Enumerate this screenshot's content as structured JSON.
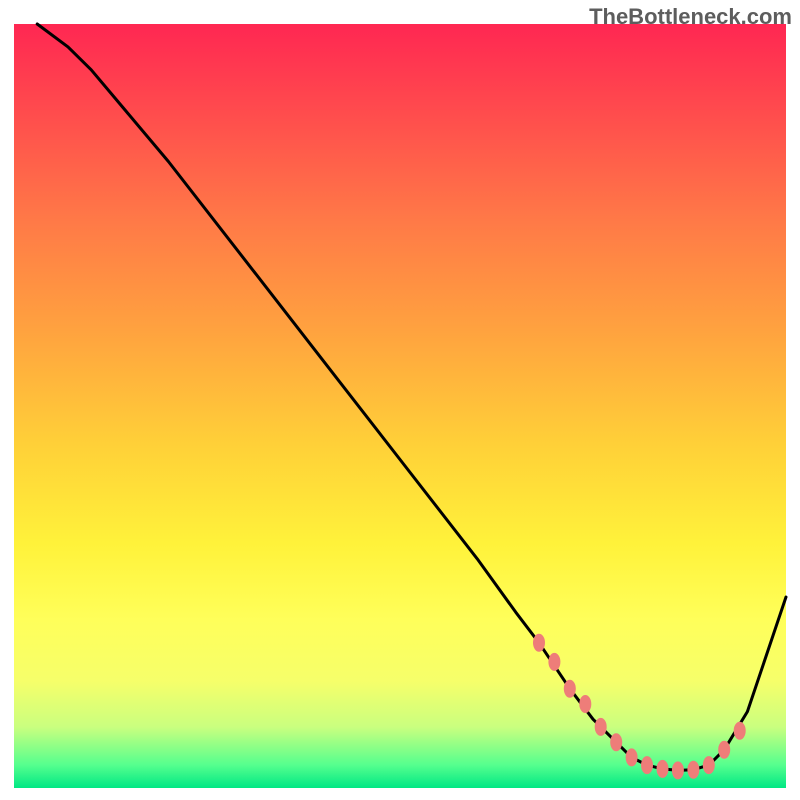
{
  "watermark": "TheBottleneck.com",
  "chart_data": {
    "type": "line",
    "title": "",
    "xlabel": "",
    "ylabel": "",
    "xlim": [
      0,
      100
    ],
    "ylim": [
      0,
      100
    ],
    "grid": false,
    "legend": false,
    "series": [
      {
        "name": "curve",
        "x": [
          3,
          7,
          10,
          20,
          30,
          40,
          50,
          60,
          65,
          68,
          72,
          75,
          78,
          80,
          82,
          84,
          86,
          88,
          90,
          92,
          95,
          100
        ],
        "y": [
          100,
          97,
          94,
          82,
          69,
          56,
          43,
          30,
          23,
          19,
          13,
          9,
          6,
          4,
          3,
          2.5,
          2.3,
          2.4,
          3,
          5,
          10,
          25
        ]
      }
    ],
    "markers": {
      "name": "trough-points",
      "x": [
        68,
        70,
        72,
        74,
        76,
        78,
        80,
        82,
        84,
        86,
        88,
        90,
        92,
        94
      ],
      "y": [
        19,
        16.5,
        13,
        11,
        8,
        6,
        4,
        3,
        2.5,
        2.3,
        2.4,
        3,
        5,
        7.5
      ]
    },
    "background": "vertical-gradient",
    "gradient_colors": [
      "#ff2752",
      "#ffd038",
      "#ffff5a",
      "#00e884"
    ]
  }
}
